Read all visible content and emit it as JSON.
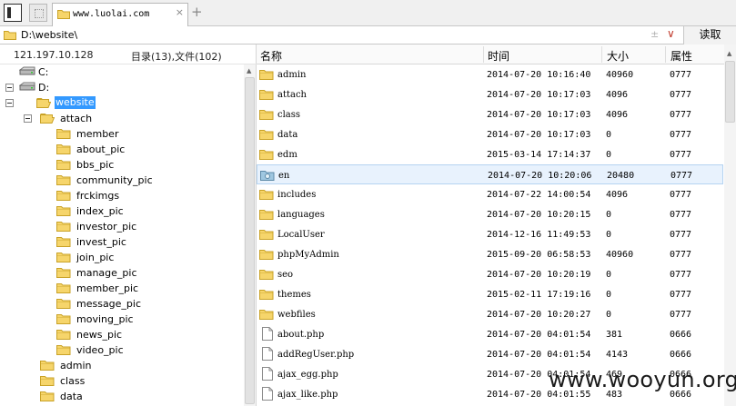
{
  "tabbar": {
    "tab_url": "www.luolai.com",
    "close_glyph": "×",
    "add_glyph": "+"
  },
  "address": {
    "path": "D:\\website\\",
    "sort_glyph": "±",
    "dropdown_glyph": "∨",
    "read_button": "读取"
  },
  "left_panel": {
    "ip": "121.197.10.128",
    "counts": "目录(13),文件(102)",
    "tree": [
      {
        "label": "C:",
        "icon": "drive-icon",
        "level": 0,
        "toggle": false,
        "selected": false
      },
      {
        "label": "D:",
        "icon": "drive-icon",
        "level": 0,
        "toggle": true,
        "selected": false
      },
      {
        "label": "website",
        "icon": "folder-open-icon",
        "level": 1,
        "toggle": true,
        "selected": true
      },
      {
        "label": "attach",
        "icon": "folder-open-icon",
        "level": 2,
        "toggle": true,
        "selected": false
      },
      {
        "label": "member",
        "icon": "folder-icon",
        "level": 3,
        "toggle": false,
        "selected": false
      },
      {
        "label": "about_pic",
        "icon": "folder-icon",
        "level": 3,
        "toggle": false,
        "selected": false
      },
      {
        "label": "bbs_pic",
        "icon": "folder-icon",
        "level": 3,
        "toggle": false,
        "selected": false
      },
      {
        "label": "community_pic",
        "icon": "folder-icon",
        "level": 3,
        "toggle": false,
        "selected": false
      },
      {
        "label": "frckimgs",
        "icon": "folder-icon",
        "level": 3,
        "toggle": false,
        "selected": false
      },
      {
        "label": "index_pic",
        "icon": "folder-icon",
        "level": 3,
        "toggle": false,
        "selected": false
      },
      {
        "label": "investor_pic",
        "icon": "folder-icon",
        "level": 3,
        "toggle": false,
        "selected": false
      },
      {
        "label": "invest_pic",
        "icon": "folder-icon",
        "level": 3,
        "toggle": false,
        "selected": false
      },
      {
        "label": "join_pic",
        "icon": "folder-icon",
        "level": 3,
        "toggle": false,
        "selected": false
      },
      {
        "label": "manage_pic",
        "icon": "folder-icon",
        "level": 3,
        "toggle": false,
        "selected": false
      },
      {
        "label": "member_pic",
        "icon": "folder-icon",
        "level": 3,
        "toggle": false,
        "selected": false
      },
      {
        "label": "message_pic",
        "icon": "folder-icon",
        "level": 3,
        "toggle": false,
        "selected": false
      },
      {
        "label": "moving_pic",
        "icon": "folder-icon",
        "level": 3,
        "toggle": false,
        "selected": false
      },
      {
        "label": "news_pic",
        "icon": "folder-icon",
        "level": 3,
        "toggle": false,
        "selected": false
      },
      {
        "label": "video_pic",
        "icon": "folder-icon",
        "level": 3,
        "toggle": false,
        "selected": false
      },
      {
        "label": "admin",
        "icon": "folder-icon",
        "level": 2,
        "toggle": false,
        "selected": false
      },
      {
        "label": "class",
        "icon": "folder-icon",
        "level": 2,
        "toggle": false,
        "selected": false
      },
      {
        "label": "data",
        "icon": "folder-icon",
        "level": 2,
        "toggle": false,
        "selected": false
      }
    ]
  },
  "file_list": {
    "columns": {
      "name": "名称",
      "time": "时间",
      "size": "大小",
      "perm": "属性"
    },
    "rows": [
      {
        "name": "admin",
        "time": "2014-07-20 10:16:40",
        "size": "40960",
        "perm": "0777",
        "type": "folder",
        "highlight": false
      },
      {
        "name": "attach",
        "time": "2014-07-20 10:17:03",
        "size": "4096",
        "perm": "0777",
        "type": "folder",
        "highlight": false
      },
      {
        "name": "class",
        "time": "2014-07-20 10:17:03",
        "size": "4096",
        "perm": "0777",
        "type": "folder",
        "highlight": false
      },
      {
        "name": "data",
        "time": "2014-07-20 10:17:03",
        "size": "0",
        "perm": "0777",
        "type": "folder",
        "highlight": false
      },
      {
        "name": "edm",
        "time": "2015-03-14 17:14:37",
        "size": "0",
        "perm": "0777",
        "type": "folder",
        "highlight": false
      },
      {
        "name": "en",
        "time": "2014-07-20 10:20:06",
        "size": "20480",
        "perm": "0777",
        "type": "folder-special",
        "highlight": true
      },
      {
        "name": "includes",
        "time": "2014-07-22 14:00:54",
        "size": "4096",
        "perm": "0777",
        "type": "folder",
        "highlight": false
      },
      {
        "name": "languages",
        "time": "2014-07-20 10:20:15",
        "size": "0",
        "perm": "0777",
        "type": "folder",
        "highlight": false
      },
      {
        "name": "LocalUser",
        "time": "2014-12-16 11:49:53",
        "size": "0",
        "perm": "0777",
        "type": "folder",
        "highlight": false
      },
      {
        "name": "phpMyAdmin",
        "time": "2015-09-20 06:58:53",
        "size": "40960",
        "perm": "0777",
        "type": "folder",
        "highlight": false
      },
      {
        "name": "seo",
        "time": "2014-07-20 10:20:19",
        "size": "0",
        "perm": "0777",
        "type": "folder",
        "highlight": false
      },
      {
        "name": "themes",
        "time": "2015-02-11 17:19:16",
        "size": "0",
        "perm": "0777",
        "type": "folder",
        "highlight": false
      },
      {
        "name": "webfiles",
        "time": "2014-07-20 10:20:27",
        "size": "0",
        "perm": "0777",
        "type": "folder",
        "highlight": false
      },
      {
        "name": "about.php",
        "time": "2014-07-20 04:01:54",
        "size": "381",
        "perm": "0666",
        "type": "file",
        "highlight": false
      },
      {
        "name": "addRegUser.php",
        "time": "2014-07-20 04:01:54",
        "size": "4143",
        "perm": "0666",
        "type": "file",
        "highlight": false
      },
      {
        "name": "ajax_egg.php",
        "time": "2014-07-20 04:01:54",
        "size": "469",
        "perm": "0666",
        "type": "file",
        "highlight": false
      },
      {
        "name": "ajax_like.php",
        "time": "2014-07-20 04:01:55",
        "size": "483",
        "perm": "0666",
        "type": "file",
        "highlight": false
      }
    ]
  },
  "watermark": "www.wooyun.org",
  "colors": {
    "folder_fill": "#f6d56b",
    "folder_stroke": "#c9a227",
    "selection": "#3399ff",
    "row_highlight": "#e8f2fd",
    "dropdown_accent": "#c0392b"
  }
}
